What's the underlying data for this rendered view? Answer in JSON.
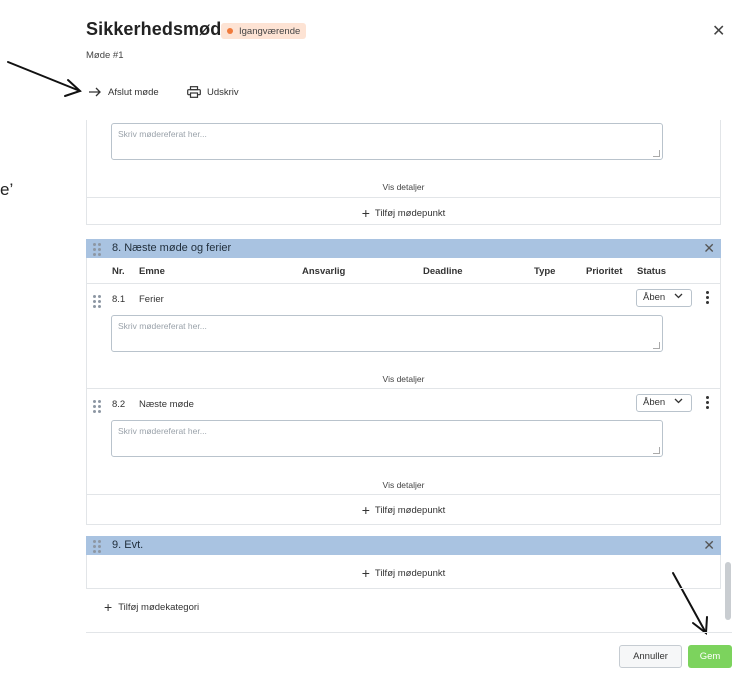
{
  "modal": {
    "title": "Sikkerhedsmøde",
    "status_badge": "Igangværende",
    "subtitle": "Møde #1",
    "close_icon": "close-icon"
  },
  "toolbar": {
    "end_meeting_label": "Afslut møde",
    "print_label": "Udskriv"
  },
  "notes_placeholder": "Skriv mødereferat her...",
  "details_label": "Vis detaljer",
  "add_item_label": "Tilføj mødepunkt",
  "columns": [
    "Nr.",
    "Emne",
    "Ansvarlig",
    "Deadline",
    "Type",
    "Prioritet",
    "Status"
  ],
  "categories": [
    {
      "title": "8. Næste møde og ferier",
      "items": [
        {
          "nr": "8.1",
          "emne": "Ferier",
          "status": "Åben"
        },
        {
          "nr": "8.2",
          "emne": "Næste møde",
          "status": "Åben"
        }
      ]
    },
    {
      "title": "9. Evt.",
      "items": []
    }
  ],
  "add_category_label": "Tilføj mødekategori",
  "footer": {
    "cancel_label": "Annuller",
    "save_label": "Gem"
  },
  "edge_text": "e’",
  "colors": {
    "category_header": "#a9c3e1",
    "save_button": "#7cd35d",
    "badge_bg": "#fde3d4",
    "badge_dot": "#f07a3c",
    "annotation_arrow": "#111111"
  }
}
